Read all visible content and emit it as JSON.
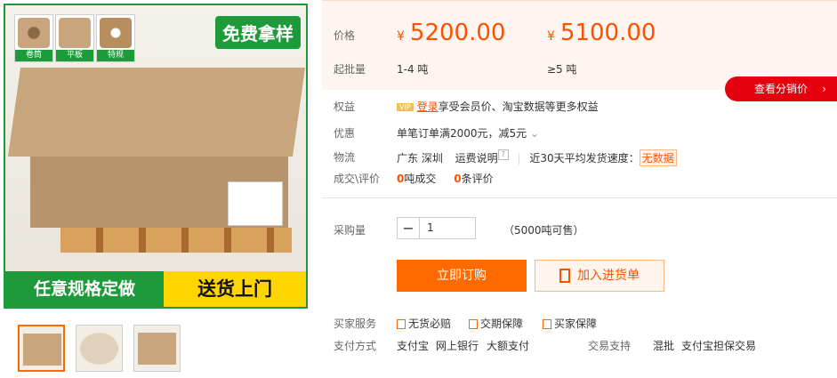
{
  "gallery": {
    "swatches": [
      "卷筒",
      "平板",
      "特规"
    ],
    "badge": "免费拿样",
    "banner_left": "任意规格定做",
    "banner_right": "送货上门"
  },
  "price": {
    "label": "价格",
    "currency": "¥",
    "tier1": "5200.00",
    "tier2": "5100.00",
    "moq_label": "起批量",
    "moq1": "1-4 吨",
    "moq2": "≥5 吨",
    "distribution_button": "查看分销价",
    "distribution_arrow": "›"
  },
  "benefit": {
    "label": "权益",
    "vip": "VIP",
    "login": "登录",
    "text": "享受会员价、淘宝数据等更多权益"
  },
  "discount": {
    "label": "优惠",
    "text": "单笔订单满2000元，减5元",
    "arrow": "⌄"
  },
  "logistics": {
    "label": "物流",
    "from": "广东 深圳",
    "fee_link": "运费说明",
    "help": "?",
    "speed_label": "近30天平均发货速度：",
    "speed_value": "无数据"
  },
  "deal": {
    "label": "成交\\评价",
    "tons": "0",
    "tons_unit": "吨成交",
    "reviews": "0",
    "reviews_unit": "条评价"
  },
  "purchase": {
    "label": "采购量",
    "minus": "−",
    "qty": "1",
    "stock": "（5000吨可售）"
  },
  "buttons": {
    "buy": "立即订购",
    "cart": "加入进货单"
  },
  "service": {
    "label": "买家服务",
    "items": [
      "无货必赔",
      "交期保障",
      "买家保障"
    ]
  },
  "payment": {
    "label": "支付方式",
    "items": [
      "支付宝",
      "网上银行",
      "大额支付"
    ]
  },
  "trade": {
    "label": "交易支持",
    "items": [
      "混批",
      "支付宝担保交易"
    ]
  },
  "colors": {
    "accent": "#ff5000",
    "button": "#ff6a00",
    "green": "#1d9b3a",
    "red": "#e4000f"
  }
}
